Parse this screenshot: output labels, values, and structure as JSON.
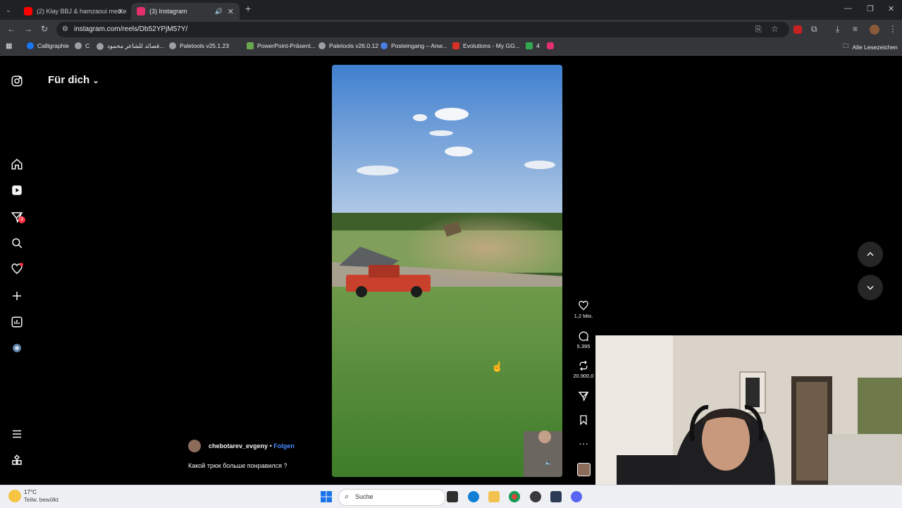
{
  "browser": {
    "tabs": [
      {
        "title": "(2) Klay BBJ & hamzaoui med e",
        "active": false,
        "favicon_color": "#ff0000"
      },
      {
        "title": "(3) Instagram",
        "active": true,
        "favicon_color": "#e1306c"
      }
    ],
    "url": "instagram.com/reels/Db52YPjM57Y/",
    "bookmarks": [
      {
        "label": "Calligraphie",
        "color": "#1877f2"
      },
      {
        "label": "C",
        "color": "#9aa0a6"
      },
      {
        "label": "قصائد للشاعر محمود...",
        "color": "#9aa0a6"
      },
      {
        "label": "Paletools v25.1.23",
        "color": "#9aa0a6"
      },
      {
        "label": "PowerPoint-Präsent...",
        "color": "#6aa84f"
      },
      {
        "label": "Paletools v26.0.12",
        "color": "#9aa0a6"
      },
      {
        "label": "Posteingang – Anw...",
        "color": "#4a7ee0"
      },
      {
        "label": "Evolutions - My GG...",
        "color": "#d93025"
      },
      {
        "label": "4",
        "color": "#34a853"
      }
    ],
    "all_bookmarks_label": "Alle Lesezeichen"
  },
  "instagram": {
    "feed_title": "Für dich",
    "notification_count": "3",
    "reel": {
      "username": "chebotarev_evgeny",
      "follow_label": "Folgen",
      "separator": "•",
      "caption": "Какой трюк больше понравился ?",
      "likes": "1,2 Mio.",
      "comments": "5.395",
      "reposts": "20.900,0"
    }
  },
  "taskbar": {
    "weather_temp": "17°C",
    "weather_desc": "Teilw. bewölkt",
    "search_label": "Suche"
  }
}
